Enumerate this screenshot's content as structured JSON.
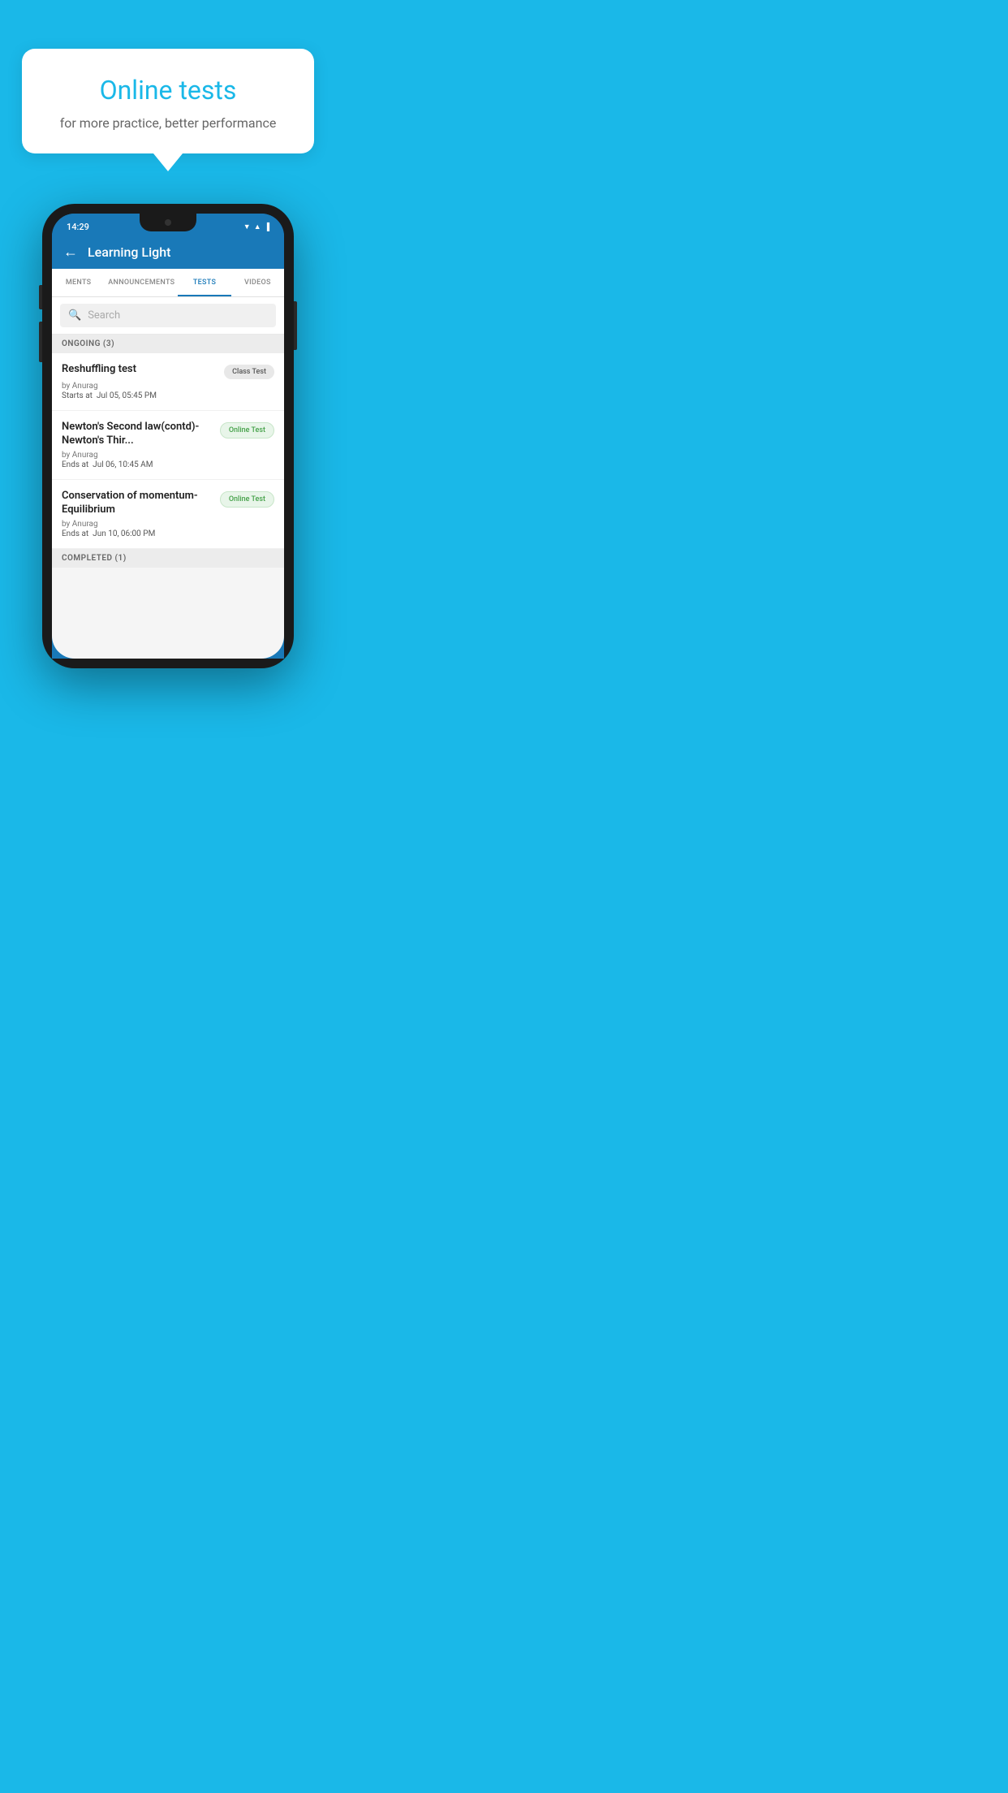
{
  "background_color": "#1ab8e8",
  "speech_bubble": {
    "title": "Online tests",
    "subtitle": "for more practice, better performance"
  },
  "phone": {
    "status_bar": {
      "time": "14:29",
      "icons": [
        "▼",
        "▲",
        "▐"
      ]
    },
    "app_bar": {
      "title": "Learning Light",
      "back_icon": "←"
    },
    "tabs": [
      {
        "label": "MENTS",
        "active": false
      },
      {
        "label": "ANNOUNCEMENTS",
        "active": false
      },
      {
        "label": "TESTS",
        "active": true
      },
      {
        "label": "VIDEOS",
        "active": false
      }
    ],
    "search": {
      "placeholder": "Search",
      "icon": "🔍"
    },
    "ongoing_section": {
      "label": "ONGOING (3)",
      "items": [
        {
          "name": "Reshuffling test",
          "badge": "Class Test",
          "badge_type": "class",
          "author": "by Anurag",
          "time_label": "Starts at",
          "time_value": "Jul 05, 05:45 PM"
        },
        {
          "name": "Newton's Second law(contd)-Newton's Thir...",
          "badge": "Online Test",
          "badge_type": "online",
          "author": "by Anurag",
          "time_label": "Ends at",
          "time_value": "Jul 06, 10:45 AM"
        },
        {
          "name": "Conservation of momentum-Equilibrium",
          "badge": "Online Test",
          "badge_type": "online",
          "author": "by Anurag",
          "time_label": "Ends at",
          "time_value": "Jun 10, 06:00 PM"
        }
      ]
    },
    "completed_section": {
      "label": "COMPLETED (1)"
    }
  }
}
